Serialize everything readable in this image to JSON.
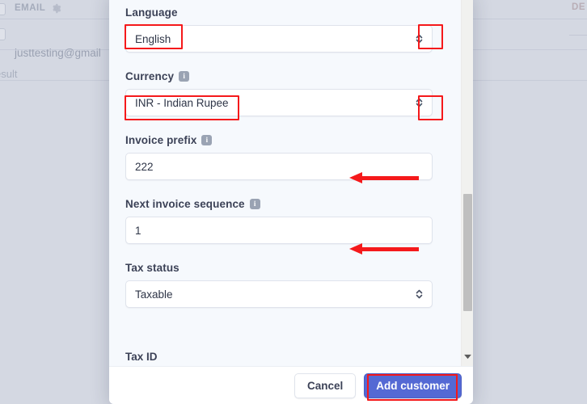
{
  "background": {
    "column_header_email": "EMAIL",
    "gear_icon": "gear-icon",
    "email_value": "justtesting@gmail",
    "result_text": "esult",
    "right_column_header": "DE"
  },
  "modal": {
    "fields": [
      {
        "label": "Language",
        "value": "English",
        "type": "select",
        "has_info": false,
        "highlighted": true
      },
      {
        "label": "Currency",
        "value": "INR - Indian Rupee",
        "type": "select",
        "has_info": true,
        "highlighted": true
      },
      {
        "label": "Invoice prefix",
        "value": "222",
        "type": "text",
        "has_info": true,
        "highlighted": false
      },
      {
        "label": "Next invoice sequence",
        "value": "1",
        "type": "text",
        "has_info": true,
        "highlighted": false
      },
      {
        "label": "Tax status",
        "value": "Taxable",
        "type": "select",
        "has_info": false,
        "highlighted": false
      }
    ],
    "clipped_next_label": "Tax ID",
    "info_icon_glyph": "i",
    "footer": {
      "cancel_label": "Cancel",
      "submit_label": "Add customer"
    }
  },
  "colors": {
    "accent_blue": "#5469d4",
    "highlight_red": "#f5191b",
    "modal_background": "#f6f9fd",
    "backdrop": "#d4d8e2",
    "label_text": "#3c4257"
  }
}
